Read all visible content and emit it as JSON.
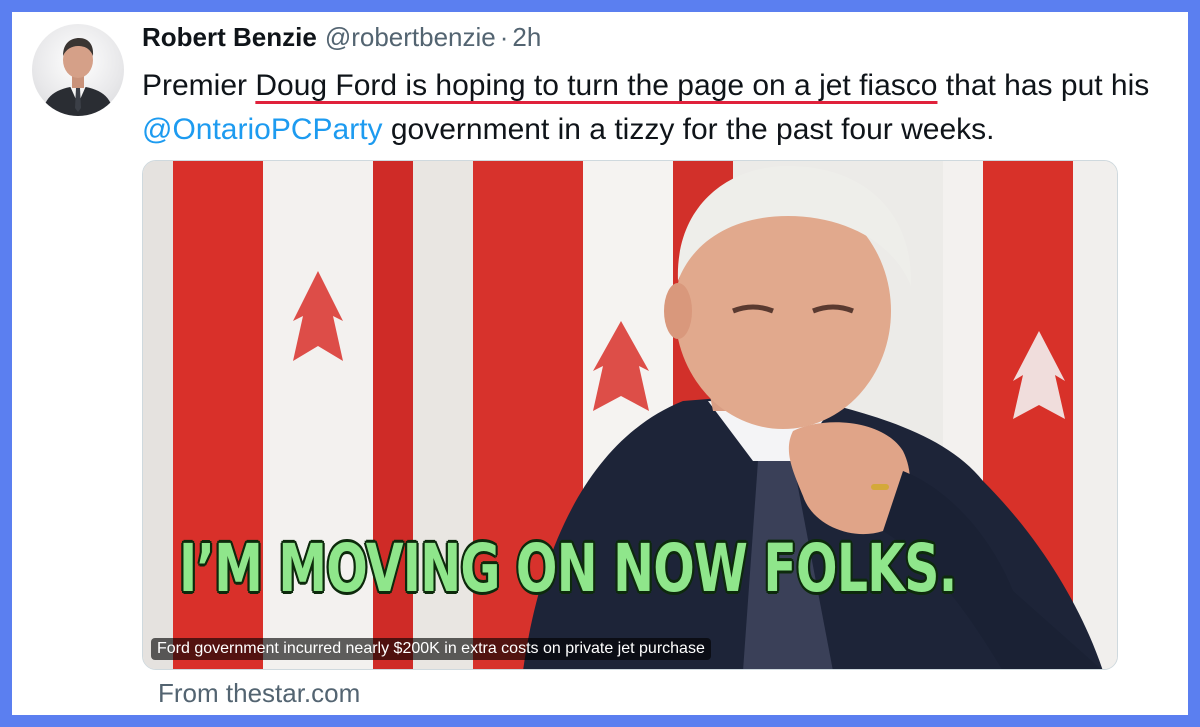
{
  "tweet": {
    "author_name": "Robert Benzie",
    "author_handle": "@robertbenzie",
    "separator": "·",
    "time": "2h",
    "text_before": "Premier ",
    "text_underlined": "Doug Ford is hoping to turn the page on a jet fiasco",
    "text_middle": " that has put his ",
    "mention": "@OntarioPCParty",
    "text_after": " government in a tizzy for the past four weeks."
  },
  "media": {
    "overlay_text": "I’M MOVING ON NOW FOLKS.",
    "caption": "Ford government incurred nearly $200K in extra costs on private jet purchase",
    "source": "From thestar.com"
  },
  "colors": {
    "background": "#5b7ff0",
    "mention": "#1d9bf0",
    "underline": "#e0213b",
    "overlay_text": "#8fe68b"
  }
}
